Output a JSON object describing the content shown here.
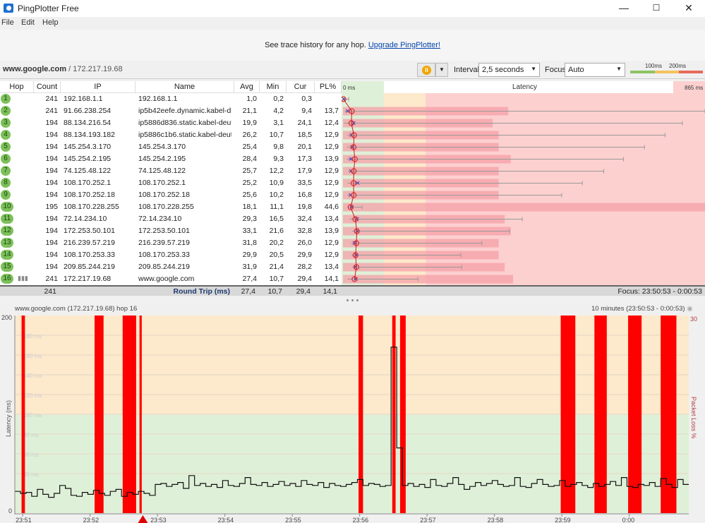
{
  "window": {
    "title": "PingPlotter Free",
    "minimize": "—",
    "maximize": "☐",
    "close": "✕"
  },
  "menu": [
    "File",
    "Edit",
    "Help"
  ],
  "banner": {
    "text": "See trace history for any hop. ",
    "link": "Upgrade PingPlotter!"
  },
  "toolbar": {
    "target_host": "www.google.com",
    "target_ip": " / 172.217.19.68",
    "interval_label": "Interval",
    "interval_value": "2,5 seconds",
    "focus_label": "Focus",
    "focus_value": "Auto",
    "scale_100": "100ms",
    "scale_200": "200ms"
  },
  "colors": {
    "green": "#dff0d8",
    "yellow": "#fde9cc",
    "red": "#fdd0d0",
    "loss": "#ff0000",
    "hop_badge": "#7dc05b"
  },
  "table": {
    "headers": [
      "Hop",
      "Count",
      "IP",
      "Name",
      "Avg",
      "Min",
      "Cur",
      "PL%"
    ],
    "graph_header": {
      "min_label": "0 ms",
      "title": "Latency",
      "max_label": "865 ms"
    },
    "rows": [
      {
        "hop": "1",
        "count": "241",
        "ip": "192.168.1.1",
        "name": "192.168.1.1",
        "avg": "1,0",
        "min": "0,2",
        "cur": "0,3",
        "pl": "",
        "max_ms": 17
      },
      {
        "hop": "2",
        "count": "241",
        "ip": "91.66.238.254",
        "name": "ip5b42eefe.dynamic.kabel-de",
        "avg": "21,1",
        "min": "4,2",
        "cur": "9,4",
        "pl": "13,7",
        "max_ms": 865
      },
      {
        "hop": "3",
        "count": "194",
        "ip": "88.134.216.54",
        "name": "ip5886d836.static.kabel-deut",
        "avg": "19,9",
        "min": "3,1",
        "cur": "24,1",
        "pl": "12,4",
        "max_ms": 811
      },
      {
        "hop": "4",
        "count": "194",
        "ip": "88.134.193.182",
        "name": "ip5886c1b6.static.kabel-deut",
        "avg": "26,2",
        "min": "10,7",
        "cur": "18,5",
        "pl": "12,9",
        "max_ms": 770
      },
      {
        "hop": "5",
        "count": "194",
        "ip": "145.254.3.170",
        "name": "145.254.3.170",
        "avg": "25,4",
        "min": "9,8",
        "cur": "20,1",
        "pl": "12,9",
        "max_ms": 721
      },
      {
        "hop": "6",
        "count": "194",
        "ip": "145.254.2.195",
        "name": "145.254.2.195",
        "avg": "28,4",
        "min": "9,3",
        "cur": "17,3",
        "pl": "13,9",
        "max_ms": 671
      },
      {
        "hop": "7",
        "count": "194",
        "ip": "74.125.48.122",
        "name": "74.125.48.122",
        "avg": "25,7",
        "min": "12,2",
        "cur": "17,9",
        "pl": "12,9",
        "max_ms": 624
      },
      {
        "hop": "8",
        "count": "194",
        "ip": "108.170.252.1",
        "name": "108.170.252.1",
        "avg": "25,2",
        "min": "10,9",
        "cur": "33,5",
        "pl": "12,9",
        "max_ms": 573
      },
      {
        "hop": "9",
        "count": "194",
        "ip": "108.170.252.18",
        "name": "108.170.252.18",
        "avg": "25,6",
        "min": "10,2",
        "cur": "16,8",
        "pl": "12,9",
        "max_ms": 524
      },
      {
        "hop": "10",
        "count": "195",
        "ip": "108.170.228.255",
        "name": "108.170.228.255",
        "avg": "18,1",
        "min": "11,1",
        "cur": "19,8",
        "pl": "44,6",
        "max_ms": 49
      },
      {
        "hop": "11",
        "count": "194",
        "ip": "72.14.234.10",
        "name": "72.14.234.10",
        "avg": "29,3",
        "min": "16,5",
        "cur": "32,4",
        "pl": "13,4",
        "max_ms": 430
      },
      {
        "hop": "12",
        "count": "194",
        "ip": "172.253.50.101",
        "name": "172.253.50.101",
        "avg": "33,1",
        "min": "21,6",
        "cur": "32,8",
        "pl": "13,9",
        "max_ms": 400
      },
      {
        "hop": "13",
        "count": "194",
        "ip": "216.239.57.219",
        "name": "216.239.57.219",
        "avg": "31,8",
        "min": "20,2",
        "cur": "26,0",
        "pl": "12,9",
        "max_ms": 334
      },
      {
        "hop": "14",
        "count": "194",
        "ip": "108.170.253.33",
        "name": "108.170.253.33",
        "avg": "29,9",
        "min": "20,5",
        "cur": "29,9",
        "pl": "12,9",
        "max_ms": 284
      },
      {
        "hop": "15",
        "count": "194",
        "ip": "209.85.244.219",
        "name": "209.85.244.219",
        "avg": "31,9",
        "min": "21,4",
        "cur": "28,2",
        "pl": "13,4",
        "max_ms": 286
      },
      {
        "hop": "16",
        "count": "241",
        "ip": "172.217.19.68",
        "name": "www.google.com",
        "avg": "27,4",
        "min": "10,7",
        "cur": "29,4",
        "pl": "14,1",
        "max_ms": 182
      }
    ],
    "summary": {
      "count": "241",
      "label": "Round Trip (ms)",
      "avg": "27,4",
      "min": "10,7",
      "cur": "29,4",
      "pl": "14,1",
      "focus": "Focus: 23:50:53 - 0:00:53"
    }
  },
  "splitter": "• • •",
  "chart_data": {
    "type": "line",
    "title": "www.google.com (172.217.19.68) hop 16",
    "range_label": "10 minutes (23:50:53 - 0:00:53)",
    "ylabel": "Latency (ms)",
    "y2label": "Packet Loss %",
    "ylim": [
      0,
      200
    ],
    "y2_max_label": "30",
    "y_min_label": "0",
    "y_max_label": "200",
    "grid_labels": [
      "180 ms",
      "160 ms",
      "140 ms",
      "120 ms",
      "100 ms",
      "80 ms",
      "60 ms",
      "40 ms"
    ],
    "x_ticks": [
      "23:51",
      "23:52",
      "23:53",
      "23:54",
      "23:55",
      "23:56",
      "23:57",
      "23:58",
      "23:59",
      "0:00"
    ],
    "x_tick_seconds": [
      7,
      67,
      127,
      187,
      247,
      307,
      367,
      427,
      487,
      547
    ],
    "duration_s": 600,
    "sample_interval_s": 5,
    "latency": [
      22,
      20,
      21,
      17,
      24,
      19,
      16,
      20,
      28,
      25,
      18,
      17,
      21,
      19,
      23,
      20,
      18,
      22,
      24,
      17,
      21,
      19,
      22,
      20,
      18,
      29,
      30,
      27,
      29,
      31,
      25,
      38,
      28,
      30,
      27,
      29,
      26,
      33,
      28,
      27,
      30,
      36,
      29,
      28,
      31,
      27,
      29,
      32,
      28,
      30,
      27,
      33,
      29,
      28,
      31,
      26,
      30,
      28,
      27,
      29,
      31,
      34,
      28,
      30,
      29,
      27,
      28,
      168,
      66,
      28,
      30,
      27,
      29,
      26,
      34,
      28,
      27,
      30,
      36,
      29,
      24,
      27,
      31,
      28,
      30,
      33,
      29,
      27,
      28,
      36,
      27,
      26,
      30,
      34,
      29,
      27,
      28,
      33,
      27,
      29,
      31,
      28,
      26,
      30,
      27,
      29,
      32,
      28,
      36,
      27,
      26,
      29,
      28,
      31,
      27,
      35,
      29,
      26,
      34,
      29
    ],
    "loss_events_s": [
      [
        6,
        9
      ],
      [
        71,
        79
      ],
      [
        96,
        108
      ],
      [
        111,
        113
      ],
      [
        306,
        310
      ],
      [
        336,
        339
      ],
      [
        343,
        348
      ],
      [
        486,
        499
      ],
      [
        516,
        527
      ],
      [
        546,
        558
      ],
      [
        575,
        589
      ]
    ],
    "marker_s": 114
  }
}
